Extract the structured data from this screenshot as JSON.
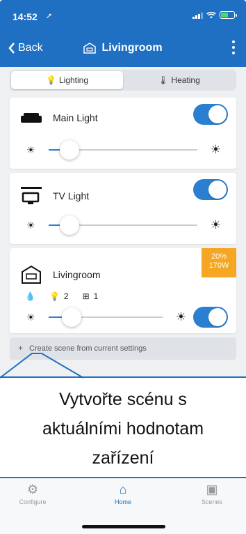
{
  "status_bar": {
    "time": "14:52"
  },
  "nav": {
    "back_label": "Back",
    "title": "Livingroom"
  },
  "tabs": [
    {
      "label": "Lighting",
      "active": true
    },
    {
      "label": "Heating",
      "active": false
    }
  ],
  "devices": [
    {
      "name": "Main Light",
      "icon": "sofa-icon",
      "on": true,
      "brightness": 0.14
    },
    {
      "name": "TV Light",
      "icon": "tv-icon",
      "on": true,
      "brightness": 0.14
    }
  ],
  "group": {
    "name": "Livingroom",
    "badge_percent": "20%",
    "badge_power": "170W",
    "bulb_count": "2",
    "room_count": "1",
    "brightness": 0.2,
    "on": true
  },
  "create_scene": {
    "label": "Create scene from current settings"
  },
  "overlay": {
    "lines": [
      "Vytvořte scénu s",
      "aktuálními hodnotam",
      "zařízení"
    ]
  },
  "bottom_nav": [
    {
      "label": "Configure",
      "icon": "gear-icon"
    },
    {
      "label": "Home",
      "icon": "home-icon",
      "active": true
    },
    {
      "label": "Scenes",
      "icon": "image-icon"
    }
  ],
  "colors": {
    "accent": "#1f6fc2",
    "badge": "#f5a623",
    "toggle_on": "#2b7fd1"
  }
}
